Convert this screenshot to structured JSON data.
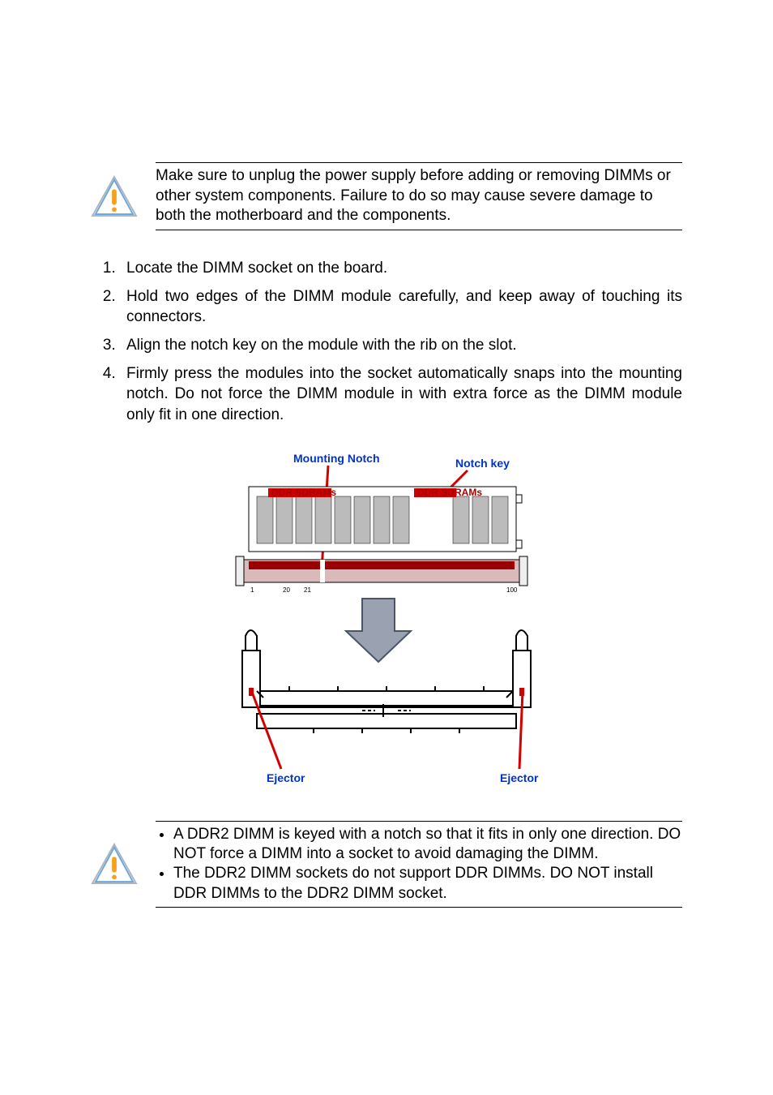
{
  "warning1": {
    "text": "Make sure to unplug the power supply before adding or removing DIMMs or other system components. Failure to do so may cause severe damage to both the motherboard and the components."
  },
  "steps": [
    "Locate the DIMM socket on the board.",
    "Hold two edges of the DIMM module carefully, and keep away of touching its connectors.",
    "Align the notch key on the module with the rib on the slot.",
    "Firmly press the modules into the socket automatically snaps into the mounting notch. Do not force the DIMM module in with extra force as the DIMM module only fit in one direction."
  ],
  "diagram": {
    "label_mounting_notch": "Mounting Notch",
    "label_notch_key": "Notch key",
    "label_ejector_left": "Ejector",
    "label_ejector_right": "Ejector",
    "label_ddr_sdram_1": "DDR SDRAMs",
    "label_ddr_sdram_2": "DDR SDRAMs"
  },
  "warning2": {
    "bullets": [
      "A DDR2 DIMM is keyed with a notch so that it fits in only one direction. DO NOT force a DIMM into a socket to avoid damaging the DIMM.",
      "The DDR2 DIMM sockets do not support DDR DIMMs. DO NOT install DDR DIMMs to the DDR2 DIMM socket."
    ]
  }
}
